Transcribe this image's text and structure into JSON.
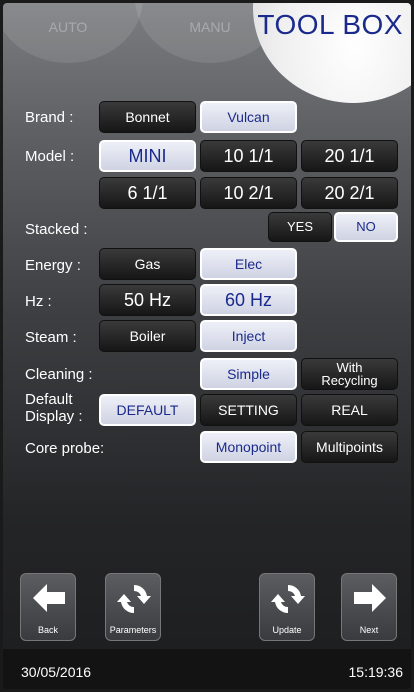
{
  "tabs": {
    "auto": "AUTO",
    "manu": "MANU",
    "toolbox": "TOOL BOX"
  },
  "brand": {
    "label": "Brand :",
    "options": [
      "Bonnet",
      "Vulcan"
    ],
    "selected": "Vulcan"
  },
  "model": {
    "label": "Model :",
    "options": [
      "MINI",
      "10 1/1",
      "20 1/1",
      "6 1/1",
      "10 2/1",
      "20 2/1"
    ],
    "selected": "MINI"
  },
  "stacked": {
    "label": "Stacked :",
    "options": [
      "YES",
      "NO"
    ],
    "selected": "NO"
  },
  "energy": {
    "label": "Energy :",
    "options": [
      "Gas",
      "Elec"
    ],
    "selected": "Elec"
  },
  "hz": {
    "label": "Hz :",
    "options": [
      "50 Hz",
      "60 Hz"
    ],
    "selected": "60 Hz"
  },
  "steam": {
    "label": "Steam :",
    "options": [
      "Boiler",
      "Inject"
    ],
    "selected": "Inject"
  },
  "cleaning": {
    "label": "Cleaning :",
    "options": [
      "Simple",
      "With Recycling"
    ],
    "selected": "Simple"
  },
  "default_display": {
    "label_line1": "Default",
    "label_line2": "Display :",
    "options": [
      "DEFAULT",
      "SETTING",
      "REAL"
    ],
    "selected": "DEFAULT"
  },
  "core_probe": {
    "label": "Core probe:",
    "options": [
      "Monopoint",
      "Multipoints"
    ],
    "selected": "Monopoint"
  },
  "nav": {
    "back": "Back",
    "parameters": "Parameters",
    "update": "Update",
    "next": "Next"
  },
  "status": {
    "date": "30/05/2016",
    "time": "15:19:36"
  },
  "colors": {
    "selected_text": "#1a2a8c",
    "selected_bg": "#dfe2f0",
    "unselected_bg": "#1e1e1e",
    "title": "#1a2a8c"
  }
}
